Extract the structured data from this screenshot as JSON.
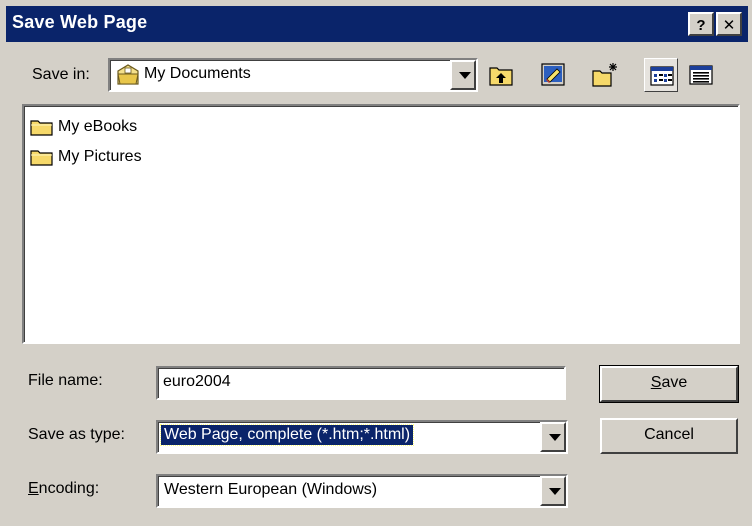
{
  "window": {
    "title": "Save Web Page",
    "help_button": "?",
    "close_button": "✕"
  },
  "save_in": {
    "label": "Save in:",
    "value": "My Documents"
  },
  "toolbar": {
    "icons": [
      "up-one-level-icon",
      "desktop-icon",
      "new-folder-icon",
      "list-view-icon",
      "details-view-icon"
    ]
  },
  "files": [
    {
      "name": "My eBooks",
      "icon": "folder-icon"
    },
    {
      "name": "My Pictures",
      "icon": "folder-icon"
    }
  ],
  "file_name": {
    "label": "File name:",
    "value": "euro2004"
  },
  "save_as_type": {
    "label": "Save as type:",
    "value": "Web Page, complete (*.htm;*.html)"
  },
  "encoding": {
    "label_rest": "ncoding:",
    "label_mnemonic": "E",
    "value": "Western European (Windows)"
  },
  "buttons": {
    "save_mnemonic": "S",
    "save_rest": "ave",
    "cancel": "Cancel"
  },
  "colors": {
    "titlebar": "#0a246a",
    "face": "#d4d0c8",
    "selection": "#0a246a"
  }
}
